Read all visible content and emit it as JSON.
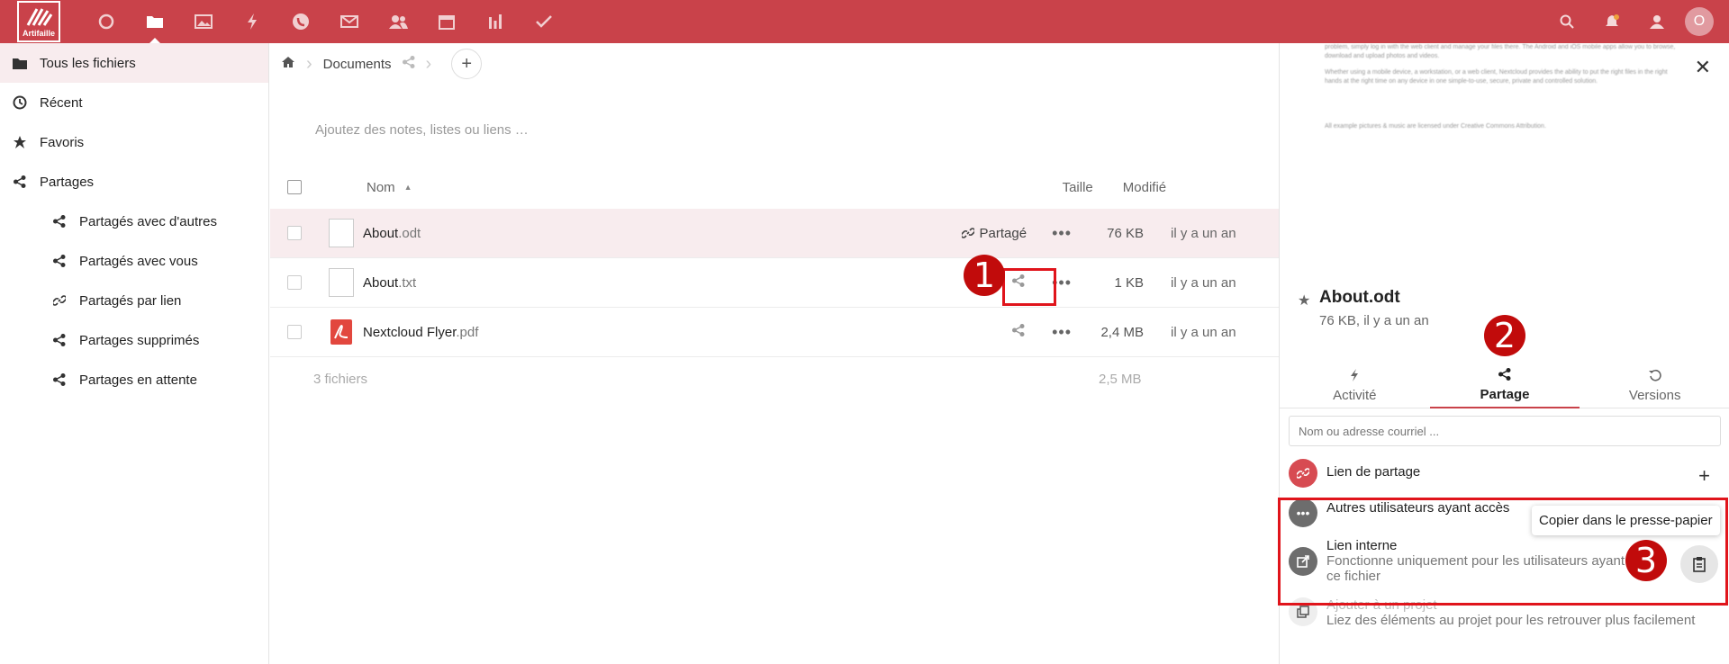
{
  "topbar": {
    "logo_text": "Artifaille",
    "apps": [
      "dashboard-icon",
      "files-icon",
      "photos-icon",
      "activity-icon",
      "talk-icon",
      "mail-icon",
      "contacts-icon",
      "calendar-icon",
      "analytics-icon",
      "tasks-icon"
    ],
    "avatar_initial": "O",
    "bg_color": "#c9424a"
  },
  "sidebar": {
    "items": [
      {
        "label": "Tous les fichiers",
        "icon": "folder-icon"
      },
      {
        "label": "Récent",
        "icon": "clock-icon"
      },
      {
        "label": "Favoris",
        "icon": "star-icon"
      },
      {
        "label": "Partages",
        "icon": "share-icon"
      },
      {
        "label": "Partagés avec d'autres",
        "icon": "share-icon"
      },
      {
        "label": "Partagés avec vous",
        "icon": "share-icon"
      },
      {
        "label": "Partagés par lien",
        "icon": "link-icon"
      },
      {
        "label": "Partages supprimés",
        "icon": "share-deleted-icon"
      },
      {
        "label": "Partages en attente",
        "icon": "share-icon"
      }
    ]
  },
  "breadcrumb": {
    "current": "Documents"
  },
  "main": {
    "notes_placeholder": "Ajoutez des notes, listes ou liens …",
    "columns": {
      "name": "Nom",
      "size": "Taille",
      "modified": "Modifié"
    },
    "files": [
      {
        "name": "About",
        "ext": ".odt",
        "shared_label": "Partagé",
        "size": "76 KB",
        "modified": "il y a un an"
      },
      {
        "name": "About",
        "ext": ".txt",
        "shared_label": "",
        "size": "1 KB",
        "modified": "il y a un an"
      },
      {
        "name": "Nextcloud Flyer",
        "ext": ".pdf",
        "shared_label": "",
        "size": "2,4 MB",
        "modified": "il y a un an"
      }
    ],
    "summary_count": "3 fichiers",
    "summary_size": "2,5 MB"
  },
  "panel": {
    "preview_lines": [
      "problem, simply log in with the web client and manage your files there. The Android and iOS mobile apps allow you to browse, download and upload photos and videos.",
      "Whether using a mobile device, a workstation, or a web client, Nextcloud provides the ability to put the right files in the right hands at the right time on any device in one simple-to-use, secure, private and controlled solution.",
      "All example pictures & music are licensed under Creative Commons Attribution."
    ],
    "file_title": "About.odt",
    "file_sub": "76 KB, il y a un an",
    "tabs": [
      {
        "label": "Activité",
        "icon": "activity-icon"
      },
      {
        "label": "Partage",
        "icon": "share-icon"
      },
      {
        "label": "Versions",
        "icon": "history-icon"
      }
    ],
    "search_placeholder": "Nom ou adresse courriel ...",
    "share_link_label": "Lien de partage",
    "others_label": "Autres utilisateurs ayant accès",
    "internal_title": "Lien interne",
    "internal_sub1": "Fonctionne uniquement pour les utilisateurs ayant",
    "internal_sub2": "ce fichier",
    "project_title": "Ajouter à un projet",
    "project_sub": "Liez des éléments au projet pour les retrouver plus facilement",
    "tooltip": "Copier dans le presse-papier"
  },
  "annotations": [
    "1",
    "2",
    "3"
  ]
}
